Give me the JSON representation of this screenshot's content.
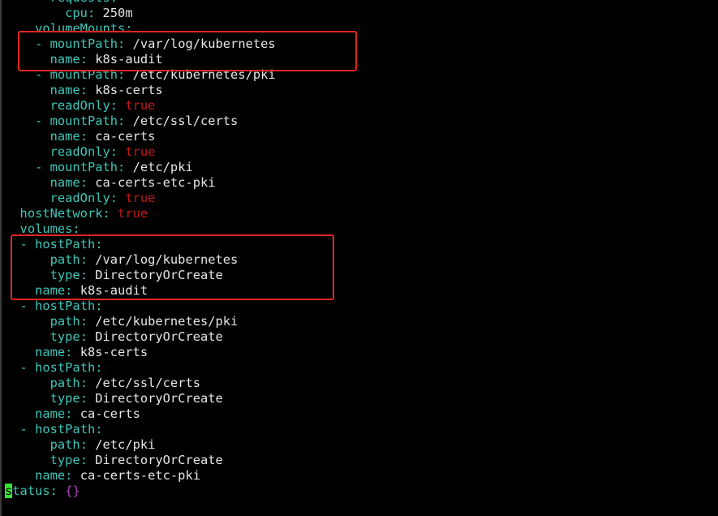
{
  "colors": {
    "background": "#000000",
    "key": "#3ec6b8",
    "plain_value": "#e6e6e6",
    "boolean_value": "#c01818",
    "brace_value": "#b43cc0",
    "cursor": "#33e633",
    "highlight_box": "#e0261f"
  },
  "cursor_char": "s",
  "lines": [
    {
      "indent": "      ",
      "dash": "",
      "key": "requests",
      "value": "",
      "vtype": "plain"
    },
    {
      "indent": "        ",
      "dash": "",
      "key": "cpu",
      "value": "250m",
      "vtype": "plain"
    },
    {
      "indent": "    ",
      "dash": "",
      "key": "volumeMounts",
      "value": "",
      "vtype": "plain"
    },
    {
      "indent": "    ",
      "dash": "- ",
      "key": "mountPath",
      "value": "/var/log/kubernetes",
      "vtype": "plain"
    },
    {
      "indent": "      ",
      "dash": "",
      "key": "name",
      "value": "k8s-audit",
      "vtype": "plain"
    },
    {
      "indent": "    ",
      "dash": "- ",
      "key": "mountPath",
      "value": "/etc/kubernetes/pki",
      "vtype": "plain"
    },
    {
      "indent": "      ",
      "dash": "",
      "key": "name",
      "value": "k8s-certs",
      "vtype": "plain"
    },
    {
      "indent": "      ",
      "dash": "",
      "key": "readOnly",
      "value": "true",
      "vtype": "bool"
    },
    {
      "indent": "    ",
      "dash": "- ",
      "key": "mountPath",
      "value": "/etc/ssl/certs",
      "vtype": "plain"
    },
    {
      "indent": "      ",
      "dash": "",
      "key": "name",
      "value": "ca-certs",
      "vtype": "plain"
    },
    {
      "indent": "      ",
      "dash": "",
      "key": "readOnly",
      "value": "true",
      "vtype": "bool"
    },
    {
      "indent": "    ",
      "dash": "- ",
      "key": "mountPath",
      "value": "/etc/pki",
      "vtype": "plain"
    },
    {
      "indent": "      ",
      "dash": "",
      "key": "name",
      "value": "ca-certs-etc-pki",
      "vtype": "plain"
    },
    {
      "indent": "      ",
      "dash": "",
      "key": "readOnly",
      "value": "true",
      "vtype": "bool"
    },
    {
      "indent": "  ",
      "dash": "",
      "key": "hostNetwork",
      "value": "true",
      "vtype": "bool"
    },
    {
      "indent": "  ",
      "dash": "",
      "key": "volumes",
      "value": "",
      "vtype": "plain"
    },
    {
      "indent": "  ",
      "dash": "- ",
      "key": "hostPath",
      "value": "",
      "vtype": "plain"
    },
    {
      "indent": "      ",
      "dash": "",
      "key": "path",
      "value": "/var/log/kubernetes",
      "vtype": "plain"
    },
    {
      "indent": "      ",
      "dash": "",
      "key": "type",
      "value": "DirectoryOrCreate",
      "vtype": "plain"
    },
    {
      "indent": "    ",
      "dash": "",
      "key": "name",
      "value": "k8s-audit",
      "vtype": "plain"
    },
    {
      "indent": "  ",
      "dash": "- ",
      "key": "hostPath",
      "value": "",
      "vtype": "plain"
    },
    {
      "indent": "      ",
      "dash": "",
      "key": "path",
      "value": "/etc/kubernetes/pki",
      "vtype": "plain"
    },
    {
      "indent": "      ",
      "dash": "",
      "key": "type",
      "value": "DirectoryOrCreate",
      "vtype": "plain"
    },
    {
      "indent": "    ",
      "dash": "",
      "key": "name",
      "value": "k8s-certs",
      "vtype": "plain"
    },
    {
      "indent": "  ",
      "dash": "- ",
      "key": "hostPath",
      "value": "",
      "vtype": "plain"
    },
    {
      "indent": "      ",
      "dash": "",
      "key": "path",
      "value": "/etc/ssl/certs",
      "vtype": "plain"
    },
    {
      "indent": "      ",
      "dash": "",
      "key": "type",
      "value": "DirectoryOrCreate",
      "vtype": "plain"
    },
    {
      "indent": "    ",
      "dash": "",
      "key": "name",
      "value": "ca-certs",
      "vtype": "plain"
    },
    {
      "indent": "  ",
      "dash": "- ",
      "key": "hostPath",
      "value": "",
      "vtype": "plain"
    },
    {
      "indent": "      ",
      "dash": "",
      "key": "path",
      "value": "/etc/pki",
      "vtype": "plain"
    },
    {
      "indent": "      ",
      "dash": "",
      "key": "type",
      "value": "DirectoryOrCreate",
      "vtype": "plain"
    },
    {
      "indent": "    ",
      "dash": "",
      "key": "name",
      "value": "ca-certs-etc-pki",
      "vtype": "plain"
    },
    {
      "indent": "",
      "dash": "",
      "key": "status",
      "value": "{}",
      "vtype": "brace",
      "cursor": true
    }
  ]
}
